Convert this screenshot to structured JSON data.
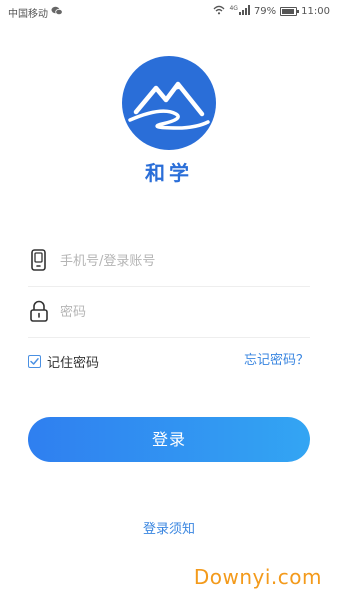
{
  "status_bar": {
    "carrier": "中国移动",
    "network": "4G",
    "battery": "79%",
    "battery_level": 0.79,
    "time": "11:00"
  },
  "app": {
    "name": "和学",
    "logo_icon": "mountain-logo-icon",
    "brand_color": "#2a6ed8"
  },
  "form": {
    "phone_placeholder": "手机号/登录账号",
    "password_placeholder": "密码",
    "remember_label": "记住密码",
    "remember_checked": true,
    "forgot_label": "忘记密码？",
    "login_label": "登录",
    "notice_label": "登录须知"
  },
  "watermark": "Downyi.com"
}
